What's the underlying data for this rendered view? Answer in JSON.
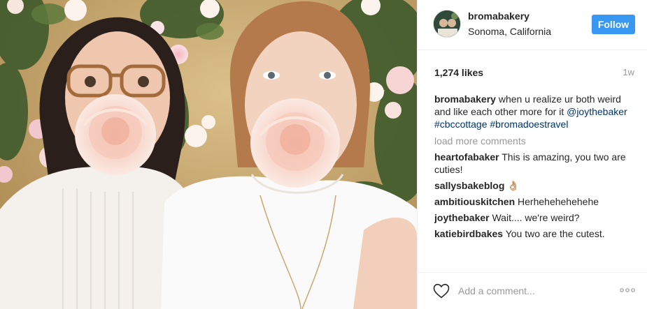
{
  "header": {
    "username": "bromabakery",
    "location": "Sonoma, California",
    "follow_label": "Follow"
  },
  "stats": {
    "likes": "1,274 likes",
    "time": "1w"
  },
  "caption": {
    "username": "bromabakery",
    "text": " when u realize ur both weird and like each other more for it ",
    "tag1": "@joythebaker",
    "tag2": "#cbccottage",
    "tag3": "#bromadoestravel"
  },
  "load_more": "load more comments",
  "comments": [
    {
      "user": "heartofabaker",
      "text": " This is amazing, you two are cuties!"
    },
    {
      "user": "sallysbakeblog",
      "text": " 👌🏼"
    },
    {
      "user": "ambitiouskitchen",
      "text": " Herhehehehehehe"
    },
    {
      "user": "joythebaker",
      "text": " Wait.... we're weird?"
    },
    {
      "user": "katiebirdbakes",
      "text": " You two are the cutest."
    }
  ],
  "footer": {
    "add_comment_placeholder": "Add a comment..."
  },
  "colors": {
    "accent": "#3897f0",
    "hashtag": "#003569",
    "muted": "#999999"
  },
  "icons": [
    "heart-icon",
    "more-options-icon"
  ]
}
